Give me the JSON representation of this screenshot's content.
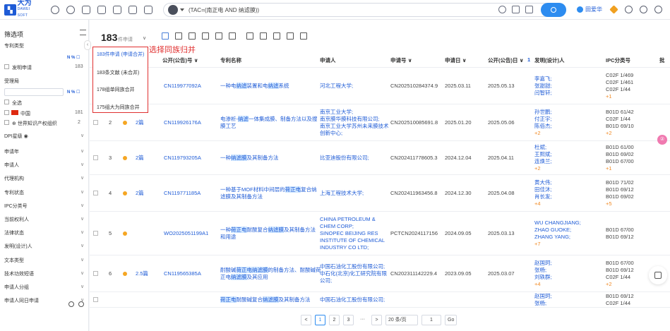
{
  "header": {
    "logo_text": "大为",
    "logo_sub": "DAWEI SOFT",
    "query": "(TAC=(南正电 AND 纳滤膜))",
    "user_name": "田爱华"
  },
  "sidebar": {
    "title": "筛选项",
    "sections": {
      "patent_type": "专利类型",
      "tools_a": "N % ☐",
      "invention_app": "发明申请",
      "invention_count": "183",
      "authority": "受理局",
      "tools_b": "N % ☐",
      "all": "全选",
      "china": "中国",
      "china_count": "181",
      "wipo": "世界知识产权组织",
      "wipo_count": "2",
      "dpi": "DPI星级 ◉"
    },
    "facets": [
      "申请年",
      "申请人",
      "代理机构",
      "专利状态",
      "IPC分类号",
      "当前权利人",
      "法律状态",
      "发明(设计)人",
      "文本类型",
      "技术功效短语",
      "申请人分组",
      "申请人同日申请"
    ]
  },
  "results": {
    "count": "183",
    "count_unit": "件申请",
    "annotation": "选择同族归并",
    "dropdown": [
      "183件申请 (申请合并)",
      "183条文献 (未合并)",
      "178组单同族合并",
      "175组大为同族合并"
    ],
    "columns": {
      "pub_no": "公开(公告)号 ∨",
      "title": "专利名称",
      "applicant": "申请人",
      "app_no": "申请号 ∨",
      "app_date": "申请日 ∨",
      "pub_date": "公开(公告)日 ∨",
      "pub_date_sort": "1",
      "inventor": "发明(设计)人",
      "ipc": "IPC分类号",
      "batch": "批"
    },
    "rows": [
      {
        "num": "",
        "dot": false,
        "badge": "",
        "pub_no": "CN119977092A",
        "title_a": "一种电纳滤装置和电纳滤系统",
        "title_b": "",
        "applicant": [
          "河北工程大学;"
        ],
        "app_no": "CN202510284374.9",
        "app_date": "2025.03.11",
        "pub_date": "2025.05.13",
        "inventors": [
          "李嘉飞;",
          "张甜甜;",
          "闫智轩;"
        ],
        "more": "",
        "ipc": [
          "C02F 1/469",
          "C02F 1/461",
          "C02F 1/44",
          "+1"
        ]
      },
      {
        "num": "2",
        "dot": true,
        "badge": "2篇",
        "pub_no": "CN119926176A",
        "title_a": "电渗析-纳滤一体集成膜、制备方法以及搜",
        "title_b": "膜工艺",
        "applicant": [
          "南京工业大学;",
          "南京膜华膜科技有限公司;",
          "南京工业大学苏州未来膜技术",
          "创新中心;"
        ],
        "app_no": "CN202510085691.8",
        "app_date": "2025.01.20",
        "pub_date": "2025.05.06",
        "inventors": [
          "孙世鹏;",
          "付正宇;",
          "陈佰杰;"
        ],
        "more": "+2",
        "ipc": [
          "B01D 61/42",
          "C02F 1/44",
          "B01D 69/10",
          "+2"
        ]
      },
      {
        "num": "3",
        "dot": true,
        "badge": "2篇",
        "pub_no": "CN119793205A",
        "title_a": "一种纳滤膜及其制备方法",
        "title_b": "",
        "applicant": [
          "比亚迪股份有限公司;"
        ],
        "app_no": "CN202411778605.3",
        "app_date": "2024.12.04",
        "pub_date": "2025.04.11",
        "inventors": [
          "杜斌;",
          "王熙斌;",
          "连焕兰;"
        ],
        "more": "+2",
        "ipc": [
          "B01D 61/00",
          "B01D 69/02",
          "B01D 67/00",
          "+1"
        ]
      },
      {
        "num": "4",
        "dot": true,
        "badge": "2篇",
        "pub_no": "CN119771185A",
        "title_a": "一种基于MOF材料中间层的荷正电复合纳",
        "title_b": "滤膜及其制备方法",
        "applicant": [
          "上海工程技术大学;"
        ],
        "app_no": "CN202411963456.8",
        "app_date": "2024.12.30",
        "pub_date": "2025.04.08",
        "inventors": [
          "黄大伟;",
          "田佳沐;",
          "肖长发;"
        ],
        "more": "+4",
        "ipc": [
          "B01D 71/02",
          "B01D 69/12",
          "B01D 69/02",
          "+5"
        ]
      },
      {
        "num": "5",
        "dot": true,
        "badge": "",
        "pub_no": "WO2025051199A1",
        "title_a": "一种荷正电耐酸复合纳滤膜及其制备方法",
        "title_b": "和用途",
        "applicant": [
          "CHINA PETROLEUM &",
          "CHEM CORP;",
          "SINOPEC BEIJING RES",
          "INSTITUTE OF CHEMICAL",
          "INDUSTRY CO LTD;"
        ],
        "app_no": "PCTCN2024117156",
        "app_date": "2024.09.05",
        "pub_date": "2025.03.13",
        "inventors": [
          "WU CHANGJIANG;",
          "ZHAO GUOKE;",
          "ZHANG YANG;"
        ],
        "more": "+7",
        "ipc": [
          "B01D 67/00",
          "B01D 69/12"
        ]
      },
      {
        "num": "6",
        "dot": true,
        "badge": "2.5篇",
        "pub_no": "CN119565385A",
        "title_a": "耐酸碱荷正电纳滤膜的制备方法、耐酸碱荷",
        "title_b": "正电纳滤膜及其应用",
        "applicant": [
          "中国石油化工股份有限公司;",
          "中石化(北京)化工研究院有限",
          "公司;"
        ],
        "app_no": "CN202311142229.4",
        "app_date": "2023.09.05",
        "pub_date": "2025.03.07",
        "inventors": [
          "赵国珂;",
          "张杨;",
          "刘轶群;"
        ],
        "more": "+4",
        "ipc": [
          "B01D 67/00",
          "B01D 69/12",
          "C02F 1/44",
          "+2"
        ]
      },
      {
        "num": "",
        "dot": false,
        "badge": "",
        "pub_no": "",
        "title_a": "荷正电耐酸碱复合纳滤膜及其制备方法",
        "title_b": "",
        "applicant": [
          "中国石油化工股份有限公司;"
        ],
        "app_no": "",
        "app_date": "",
        "pub_date": "",
        "inventors": [
          "赵国珂;",
          "张杨;"
        ],
        "more": "",
        "ipc": [
          "B01D 69/12",
          "C02F 1/44"
        ]
      }
    ]
  },
  "pagination": {
    "prev": "<",
    "pages": [
      "1",
      "2",
      "3"
    ],
    "ellipsis": "···",
    "next": ">",
    "page_size": "20 条/页",
    "jump_value": "1",
    "go": "Go"
  },
  "floating": {
    "pink_badge": "②"
  }
}
